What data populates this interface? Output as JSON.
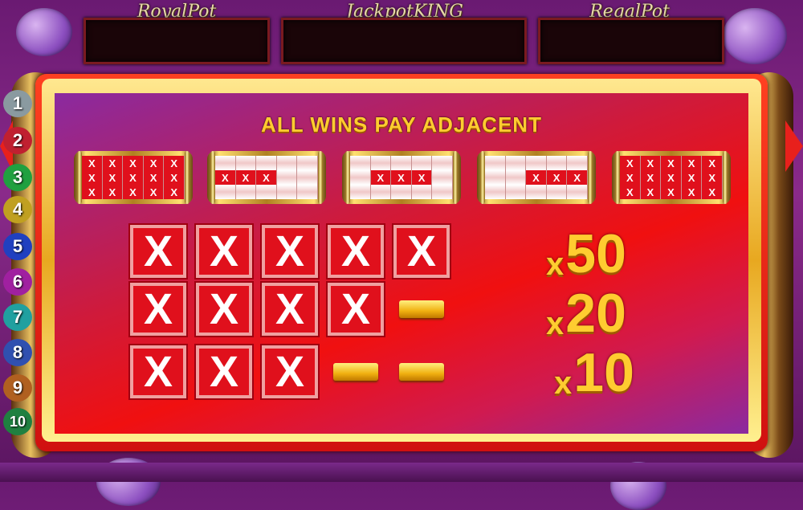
{
  "header": {
    "jackpots": [
      {
        "label": "RoyalPot",
        "value": ""
      },
      {
        "label": "JackpotKING",
        "value": ""
      },
      {
        "label": "RegalPot",
        "value": ""
      }
    ]
  },
  "paylines": [
    "1",
    "2",
    "3",
    "4",
    "5",
    "6",
    "7",
    "8",
    "9",
    "10"
  ],
  "paytable": {
    "title": "ALL WINS PAY ADJACENT",
    "reels": [
      {
        "pattern": [
          [
            "X",
            "X",
            "X",
            "X",
            "X"
          ],
          [
            "X",
            "X",
            "X",
            "X",
            "X"
          ],
          [
            "X",
            "X",
            "X",
            "X",
            "X"
          ]
        ]
      },
      {
        "pattern": [
          [
            "",
            "",
            "",
            "",
            ""
          ],
          [
            "X",
            "X",
            "X",
            "",
            ""
          ],
          [
            "",
            "",
            "",
            "",
            ""
          ]
        ]
      },
      {
        "pattern": [
          [
            "",
            "",
            "",
            "",
            ""
          ],
          [
            "",
            "X",
            "X",
            "X",
            ""
          ],
          [
            "",
            "",
            "",
            "",
            ""
          ]
        ]
      },
      {
        "pattern": [
          [
            "",
            "",
            "",
            "",
            ""
          ],
          [
            "",
            "",
            "X",
            "X",
            "X"
          ],
          [
            "",
            "",
            "",
            "",
            ""
          ]
        ]
      },
      {
        "pattern": [
          [
            "X",
            "X",
            "X",
            "X",
            "X"
          ],
          [
            "X",
            "X",
            "X",
            "X",
            "X"
          ],
          [
            "X",
            "X",
            "X",
            "X",
            "X"
          ]
        ]
      }
    ],
    "rows": [
      {
        "symbols": [
          "X",
          "X",
          "X",
          "X",
          "X"
        ],
        "multiplier_prefix": "x",
        "multiplier": "50"
      },
      {
        "symbols": [
          "X",
          "X",
          "X",
          "X",
          "-"
        ],
        "multiplier_prefix": "x",
        "multiplier": "20"
      },
      {
        "symbols": [
          "X",
          "X",
          "X",
          "-",
          "-"
        ],
        "multiplier_prefix": "x",
        "multiplier": "10"
      }
    ]
  },
  "colors": {
    "accent_gold": "#ffcc30",
    "symbol_red": "#e0101c",
    "panel_red": "#f01010"
  }
}
